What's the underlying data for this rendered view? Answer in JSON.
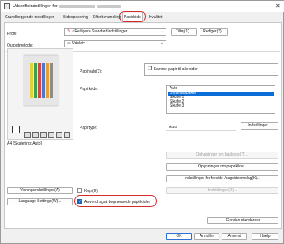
{
  "window": {
    "title": "Udskriftsindstillinger for",
    "close_glyph": "✕"
  },
  "tabs": [
    {
      "label": "Grundlæggende indstillinger"
    },
    {
      "label": "Sidespecering"
    },
    {
      "label": "Efterbehandling"
    },
    {
      "label": "Papirkilde"
    },
    {
      "label": "Kvalitet"
    }
  ],
  "profile": {
    "label": "Profil:",
    "value": "<Rediger> Standardindstillinger",
    "add_button": "Tilføj(1)...",
    "edit_button": "Rediger(2)..."
  },
  "output_method": {
    "label": "Outputmetode:",
    "value": "Udskriv"
  },
  "preview": {
    "caption": "A4 [Skalering: Auto]"
  },
  "paper_selection": {
    "label": "Papirvalg(3):",
    "value": "Samme papir til alle sider"
  },
  "paper_source": {
    "label": "Papirkilde:",
    "options": [
      "Auto",
      "Universalbakke",
      "Skuffe 1",
      "Skuffe 2",
      "Skuffe 3"
    ],
    "selected_index": 1
  },
  "paper_type": {
    "label": "Papirtype:",
    "value": "Auto",
    "settings_button": "Indstillinger..."
  },
  "info_buttons": {
    "tray_info": "Oplysninger om bakkedel(T)...",
    "paper_info": "Oplysninger om papirkilde...",
    "cover_settings": "Indstillinger for forside-/bagsideomslag(K)...",
    "disabled_settings": "Indstillinger(D)..."
  },
  "left_buttons": {
    "view_settings": "Visningsindstillinger(A)",
    "language_settings": "Language Settings(W)..."
  },
  "checkboxes": {
    "copy": {
      "label": "Kopi(U)",
      "checked": false
    },
    "limited_paper": {
      "label": "Anvend også begrænsede papirkilder",
      "checked": true
    }
  },
  "restore_defaults": "Gendan standarder",
  "footer": {
    "ok": "OK",
    "cancel": "Annuller",
    "apply": "Anvend",
    "help": "Hjælp"
  },
  "colors": {
    "highlight_red": "#d42a2a",
    "selection_blue": "#0b6dd6"
  }
}
